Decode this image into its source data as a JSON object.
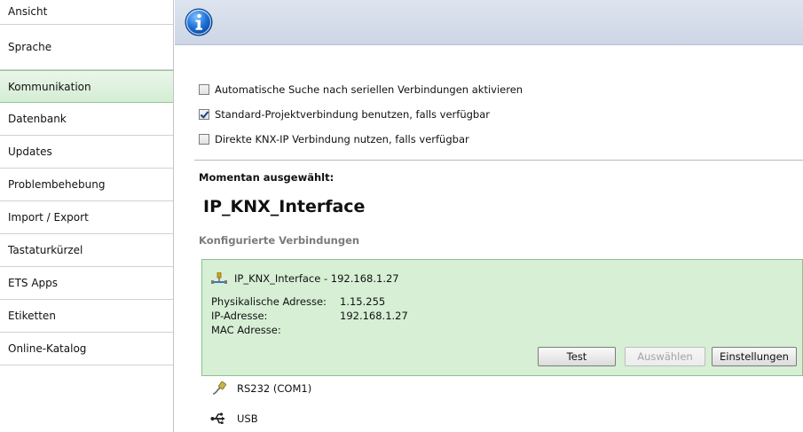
{
  "sidebar": {
    "items": [
      {
        "label": "Ansicht"
      },
      {
        "label": "Sprache"
      },
      {
        "label": "Kommunikation",
        "active": true
      },
      {
        "label": "Datenbank"
      },
      {
        "label": "Updates"
      },
      {
        "label": "Problembehebung"
      },
      {
        "label": "Import / Export"
      },
      {
        "label": "Tastaturkürzel"
      },
      {
        "label": "ETS Apps"
      },
      {
        "label": "Etiketten"
      },
      {
        "label": "Online-Katalog"
      }
    ]
  },
  "header": {
    "icon": "info-icon",
    "accent": "#1a6fd6"
  },
  "options": [
    {
      "label": "Automatische Suche nach seriellen Verbindungen aktivieren",
      "checked": false
    },
    {
      "label": "Standard-Projektverbindung benutzen, falls verfügbar",
      "checked": true
    },
    {
      "label": "Direkte KNX-IP Verbindung nutzen, falls verfügbar",
      "checked": false
    }
  ],
  "current": {
    "label": "Momentan ausgewählt:",
    "name": "IP_KNX_Interface"
  },
  "configured": {
    "heading": "Konfigurierte Verbindungen",
    "selected": {
      "icon": "network-icon",
      "title": "IP_KNX_Interface - 192.168.1.27",
      "phys_label": "Physikalische Adresse:",
      "phys_value": "1.15.255",
      "ip_label": "IP-Adresse:",
      "ip_value": "192.168.1.27",
      "mac_label": "MAC Adresse:",
      "mac_value": "",
      "buttons": {
        "test": "Test",
        "select": "Auswählen",
        "settings": "Einstellungen"
      }
    },
    "others": [
      {
        "icon": "serial-cable-icon",
        "label": "RS232 (COM1)"
      },
      {
        "icon": "usb-icon",
        "label": "USB"
      }
    ]
  }
}
